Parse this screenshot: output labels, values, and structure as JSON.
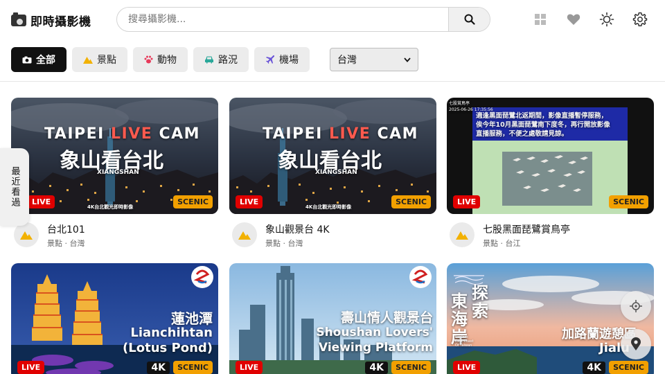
{
  "app": {
    "title": "即時攝影機"
  },
  "search": {
    "placeholder": "搜尋攝影機..."
  },
  "header_icons": [
    "grid-icon",
    "heart-icon",
    "sun-icon",
    "gear-icon"
  ],
  "filters": [
    {
      "label": "全部",
      "icon": "camera-icon",
      "active": true
    },
    {
      "label": "景點",
      "icon": "mountain-icon",
      "active": false
    },
    {
      "label": "動物",
      "icon": "paw-icon",
      "active": false
    },
    {
      "label": "路況",
      "icon": "car-icon",
      "active": false
    },
    {
      "label": "機場",
      "icon": "plane-icon",
      "active": false
    }
  ],
  "region_select": {
    "value": "台灣"
  },
  "side_tab": {
    "label": "最近看過"
  },
  "cards": [
    {
      "title": "台北101",
      "subtitle": "景點 · 台灣",
      "live": "LIVE",
      "category": "SCENIC",
      "overlay": {
        "line1a": "TAIPEI",
        "line1b": "LIVE",
        "line1c": "CAM",
        "line2": "象山看台北",
        "line3": "XIANGSHAN",
        "line4": "4K台北觀光即時影像"
      }
    },
    {
      "title": "象山觀景台 4K",
      "subtitle": "景點 · 台灣",
      "live": "LIVE",
      "category": "SCENIC",
      "overlay": {
        "line1a": "TAIPEI",
        "line1b": "LIVE",
        "line1c": "CAM",
        "line2": "象山看台北",
        "line3": "XIANGSHAN",
        "line4": "4K台北觀光即時影像"
      }
    },
    {
      "title": "七股黑面琵鷺賞鳥亭",
      "subtitle": "景點 · 台江",
      "live": "LIVE",
      "category": "SCENIC",
      "overlay": {
        "caption": "七股賞鳥亭",
        "stamp": "2025-06-26 17:35:56",
        "notice1": "適逢黑面琵鷺北返期間，影像直播暫停服務，",
        "notice2": "俟今年10月黑面琵鷺南下度冬，再行開放影像",
        "notice3": "直播服務，不便之處敬請見諒。"
      }
    },
    {
      "live": "LIVE",
      "category": "SCENIC",
      "quality": "4K",
      "overlay": {
        "line1": "蓮池潭",
        "line2": "Lianchihtan",
        "line3": "(Lotus Pond)"
      }
    },
    {
      "live": "LIVE",
      "category": "SCENIC",
      "quality": "4K",
      "overlay": {
        "line1": "壽山情人觀景台",
        "line2": "Shoushan Lovers'",
        "line3": "Viewing Platform"
      }
    },
    {
      "live": "LIVE",
      "category": "SCENIC",
      "quality": "4K",
      "overlay": {
        "v1": "東",
        "v2": "海",
        "v3": "岸",
        "v4": "探",
        "v5": "索",
        "small1": "Explore",
        "small2": "East Coast",
        "small3": "Of Taiwan",
        "line1": "加路蘭遊憩區",
        "line2": "Jialu"
      }
    }
  ],
  "colors": {
    "live": "#e00000",
    "scenic": "#f2a000",
    "active_chip": "#111111"
  }
}
